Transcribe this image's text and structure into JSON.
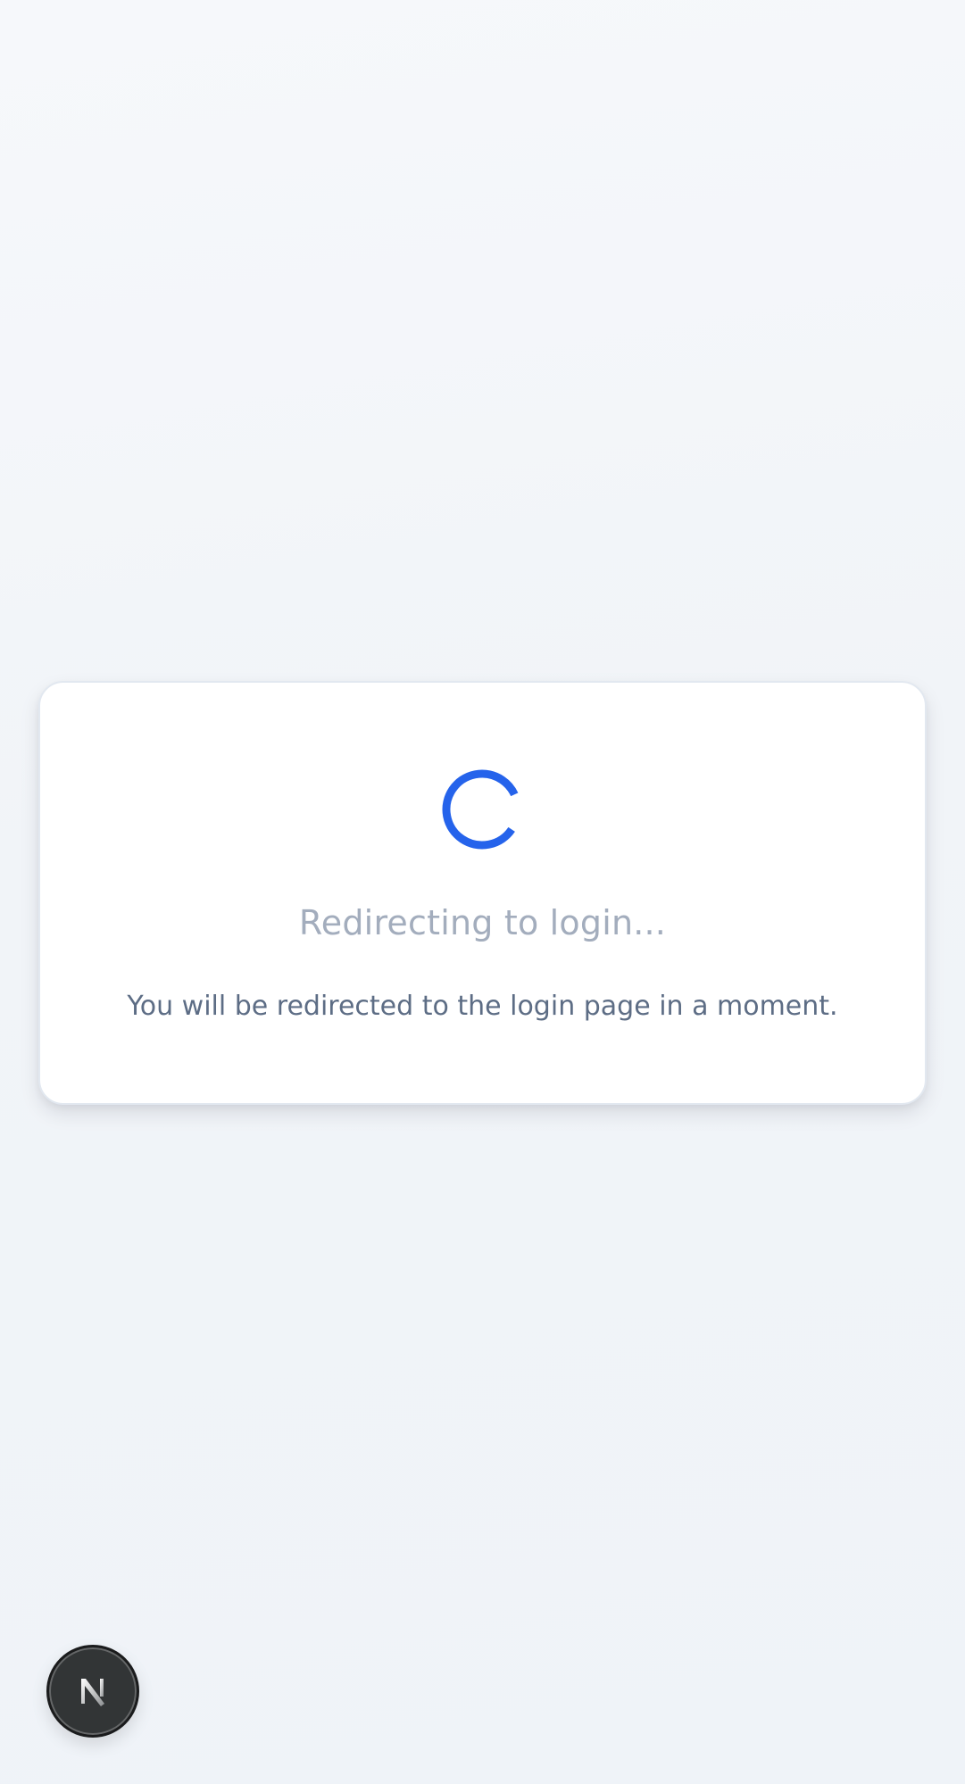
{
  "redirect": {
    "title": "Redirecting to login...",
    "message": "You will be redirected to the login page in a moment."
  },
  "spinner": {
    "icon": "loading-spinner-icon",
    "color": "#2563eb"
  },
  "dev_indicator": {
    "icon": "nextjs-logo-icon",
    "letter": "N"
  },
  "colors": {
    "accent": "#2563eb",
    "title": "#a3adbd",
    "message": "#5d6d85",
    "card_border": "#e2e8f0",
    "badge_bg": "#323536"
  }
}
